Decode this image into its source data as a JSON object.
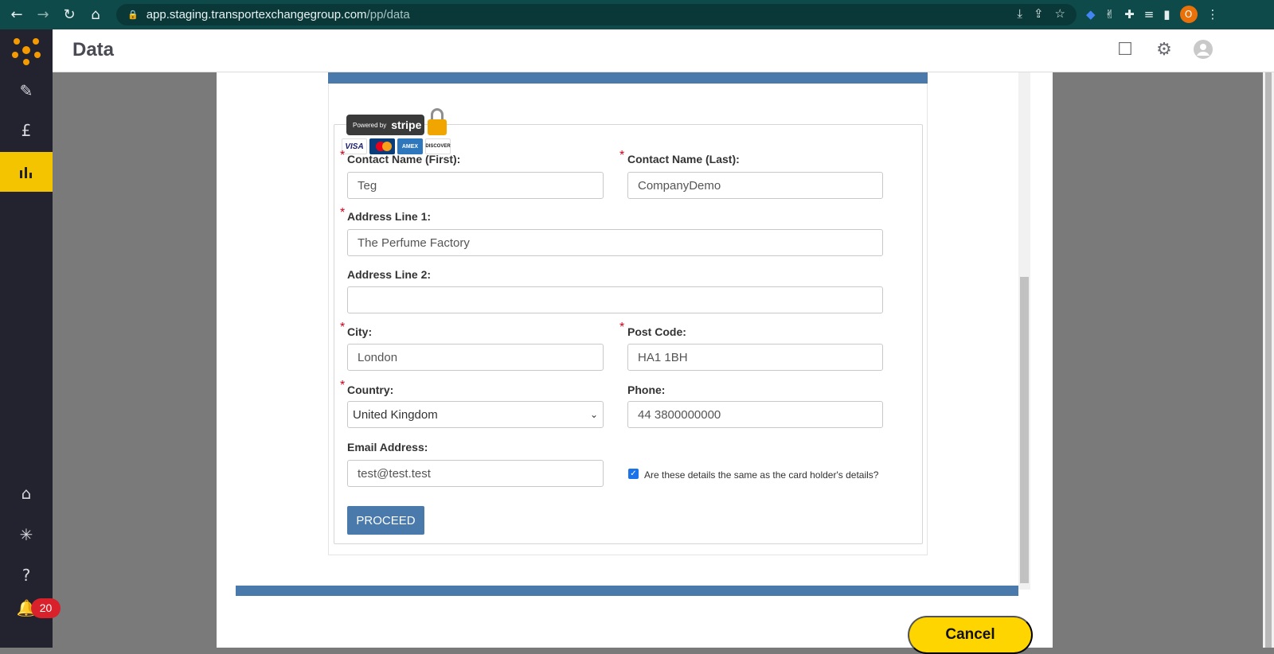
{
  "browser": {
    "url_host": "app.staging.transportexchangegroup.com",
    "url_path": "/pp/data",
    "profile_initial": "O"
  },
  "app": {
    "title": "Data",
    "notifications_count": "20",
    "accent_color": "#f5c400",
    "sidebar_bg": "#232330"
  },
  "payment": {
    "stripe_powered_by": "Powered by",
    "stripe_brand": "stripe",
    "cards": [
      "VISA",
      "MasterCard",
      "AMERICAN EXPRESS",
      "DISCOVER"
    ]
  },
  "form": {
    "first_name_label": "Contact Name (First):",
    "first_name_value": "Teg",
    "last_name_label": "Contact Name (Last):",
    "last_name_value": "CompanyDemo",
    "address1_label": "Address Line 1:",
    "address1_value": "The Perfume Factory",
    "address2_label": "Address Line 2:",
    "address2_value": "",
    "city_label": "City:",
    "city_value": "London",
    "postcode_label": "Post Code:",
    "postcode_value": "HA1 1BH",
    "country_label": "Country:",
    "country_value": "United Kingdom",
    "phone_label": "Phone:",
    "phone_value": "44 3800000000",
    "email_label": "Email Address:",
    "email_value": "test@test.test",
    "same_details_label": "Are these details the same as the card holder's details?",
    "same_details_checked": true,
    "proceed_label": "PROCEED",
    "required_marker": "*"
  },
  "modal": {
    "cancel_label": "Cancel",
    "band_color": "#4a7aab"
  }
}
